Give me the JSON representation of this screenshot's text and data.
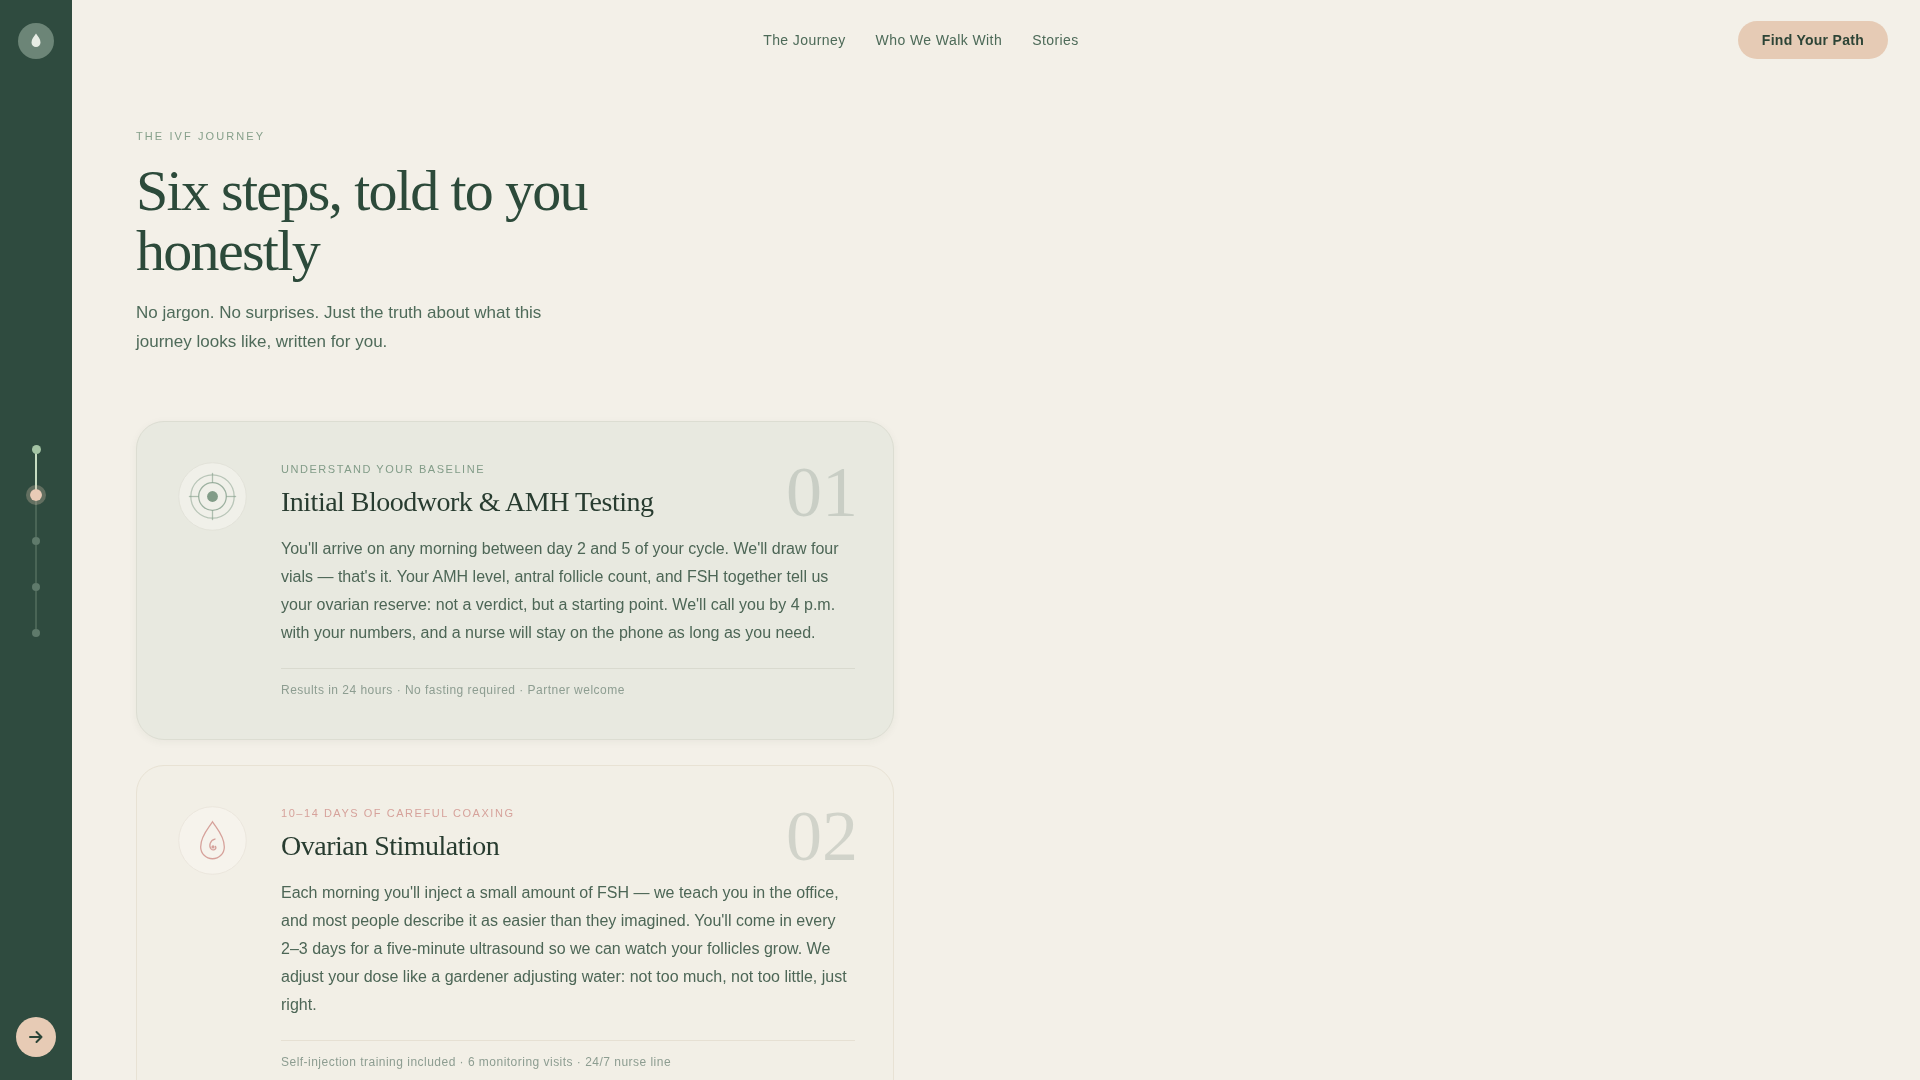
{
  "sidebar": {
    "progress": [
      {
        "done": true,
        "current": false
      },
      {
        "done": false,
        "current": true
      },
      {
        "done": false,
        "current": false
      },
      {
        "done": false,
        "current": false
      },
      {
        "done": false,
        "current": false
      }
    ]
  },
  "nav": {
    "links": [
      "The Journey",
      "Who We Walk With",
      "Stories"
    ],
    "cta": "Find Your Path"
  },
  "intro": {
    "eyebrow": "THE IVF JOURNEY",
    "title": "Six steps, told to you honestly",
    "lead": "No jargon. No surprises. Just the truth about what this journey looks like, written for you."
  },
  "steps": [
    {
      "kind": "target",
      "selected": true,
      "color": "#829c88",
      "number": "01",
      "eyebrow": "UNDERSTAND YOUR BASELINE",
      "title": "Initial Bloodwork & AMH Testing",
      "body": "You'll arrive on any morning between day 2 and 5 of your cycle. We'll draw four vials — that's it. Your AMH level, antral follicle count, and FSH together tell us your ovarian reserve: not a verdict, but a starting point. We'll call you by 4 p.m. with your numbers, and a nurse will stay on the phone as long as you need.",
      "details": "Results in 24 hours · No fasting required · Partner welcome"
    },
    {
      "kind": "drop",
      "selected": false,
      "color": "#d6a29b",
      "number": "02",
      "eyebrow": "10–14 DAYS OF CAREFUL COAXING",
      "title": "Ovarian Stimulation",
      "body": "Each morning you'll inject a small amount of FSH — we teach you in the office, and most people describe it as easier than they imagined. You'll come in every 2–3 days for a five-minute ultrasound so we can watch your follicles grow. We adjust your dose like a gardener adjusting water: not too much, not too little, just right.",
      "details": "Self-injection training included · 6 monitoring visits · 24/7 nurse line"
    }
  ]
}
